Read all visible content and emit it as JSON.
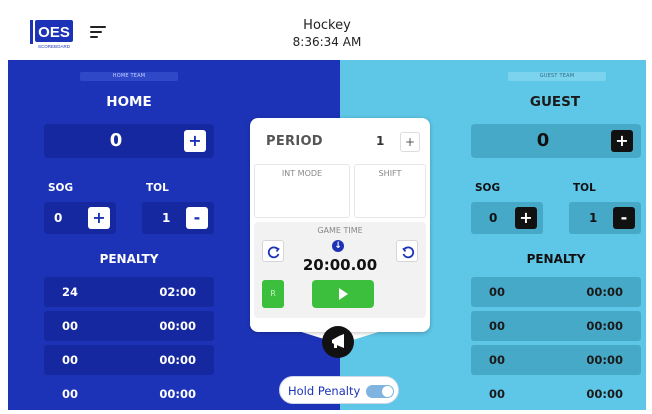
{
  "app": {
    "logo_text": "OES",
    "logo_sub": "SCOREBOARD"
  },
  "header": {
    "title": "Hockey",
    "time": "8:36:34 AM"
  },
  "colors": {
    "home": "#1c33b7",
    "guest": "#5ec6e6",
    "go": "#3cbf3c"
  },
  "home": {
    "tag": "HOME TEAM",
    "name": "HOME",
    "score": "0",
    "sog_label": "SOG",
    "tol_label": "TOL",
    "sog": "0",
    "tol": "1",
    "penalty_title": "PENALTY",
    "penalties": [
      {
        "num": "24",
        "time": "02:00"
      },
      {
        "num": "00",
        "time": "00:00"
      },
      {
        "num": "00",
        "time": "00:00"
      },
      {
        "num": "00",
        "time": "00:00"
      }
    ]
  },
  "guest": {
    "tag": "GUEST TEAM",
    "name": "GUEST",
    "score": "0",
    "sog_label": "SOG",
    "tol_label": "TOL",
    "sog": "0",
    "tol": "1",
    "penalty_title": "PENALTY",
    "penalties": [
      {
        "num": "00",
        "time": "00:00"
      },
      {
        "num": "00",
        "time": "00:00"
      },
      {
        "num": "00",
        "time": "00:00"
      },
      {
        "num": "00",
        "time": "00:00"
      }
    ]
  },
  "center": {
    "period_label": "PERIOD",
    "period": "1",
    "int_mode": "INT MODE",
    "shift": "SHIFT",
    "game_time_label": "GAME TIME",
    "game_time": "20:00.00",
    "reset_label": "R"
  },
  "buttons": {
    "plus": "+",
    "minus": "-"
  },
  "hold_penalty": {
    "label": "Hold Penalty",
    "on": true
  }
}
